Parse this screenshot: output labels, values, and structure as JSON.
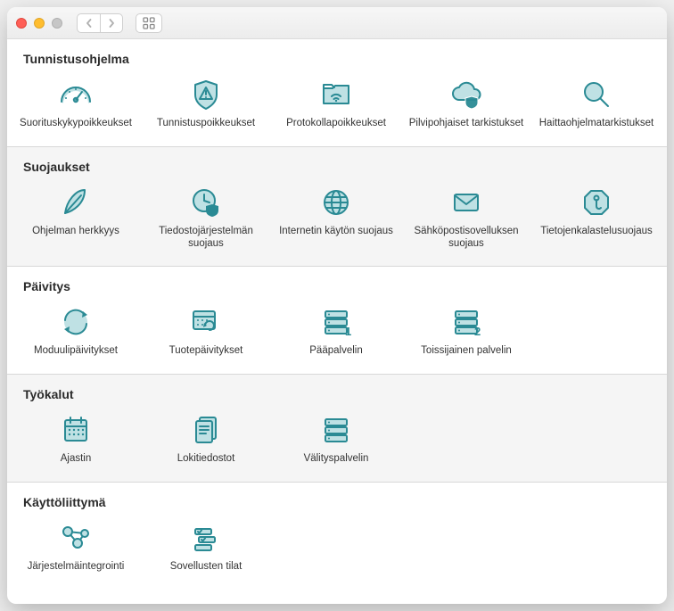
{
  "colors": {
    "accent": "#2a8a94",
    "accent_light": "#bfe1e4"
  },
  "sections": [
    {
      "title": "Tunnistusohjelma",
      "items": [
        {
          "label": "Suorituskykypoikkeukset",
          "icon": "gauge-icon"
        },
        {
          "label": "Tunnistuspoikkeukset",
          "icon": "shield-alert-icon"
        },
        {
          "label": "Protokollapoikkeukset",
          "icon": "folder-wifi-icon"
        },
        {
          "label": "Pilvipohjaiset tarkistukset",
          "icon": "cloud-shield-icon"
        },
        {
          "label": "Haittaohjelmatarkistukset",
          "icon": "magnifier-icon"
        }
      ]
    },
    {
      "title": "Suojaukset",
      "items": [
        {
          "label": "Ohjelman herkkyys",
          "icon": "feather-icon"
        },
        {
          "label": "Tiedostojärjestelmän suojaus",
          "icon": "clock-shield-icon"
        },
        {
          "label": "Internetin käytön suojaus",
          "icon": "globe-icon"
        },
        {
          "label": "Sähköpostisovelluksen suojaus",
          "icon": "envelope-icon"
        },
        {
          "label": "Tietojenkalastelusuojaus",
          "icon": "phishing-icon"
        }
      ]
    },
    {
      "title": "Päivitys",
      "items": [
        {
          "label": "Moduulipäivitykset",
          "icon": "refresh-circle-icon"
        },
        {
          "label": "Tuotepäivitykset",
          "icon": "calendar-refresh-icon"
        },
        {
          "label": "Pääpalvelin",
          "icon": "server-1-icon"
        },
        {
          "label": "Toissijainen palvelin",
          "icon": "server-2-icon"
        }
      ]
    },
    {
      "title": "Työkalut",
      "items": [
        {
          "label": "Ajastin",
          "icon": "calendar-icon"
        },
        {
          "label": "Lokitiedostot",
          "icon": "document-icon"
        },
        {
          "label": "Välityspalvelin",
          "icon": "server-icon"
        }
      ]
    },
    {
      "title": "Käyttöliittymä",
      "items": [
        {
          "label": "Järjestelmäintegrointi",
          "icon": "network-nodes-icon"
        },
        {
          "label": "Sovellusten tilat",
          "icon": "app-states-icon"
        }
      ]
    }
  ]
}
